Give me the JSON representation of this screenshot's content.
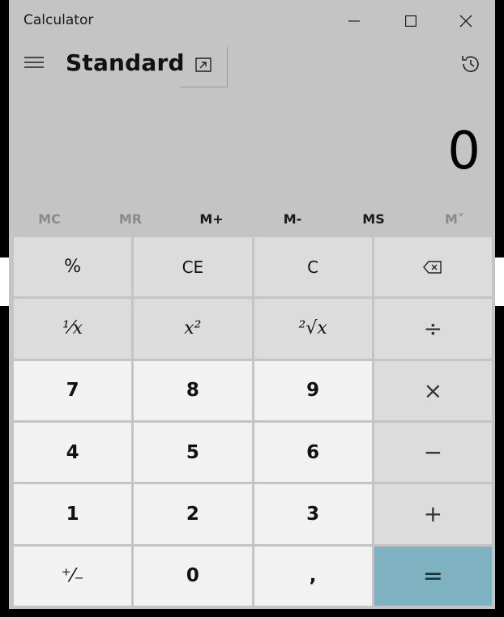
{
  "window": {
    "title": "Calculator"
  },
  "header": {
    "mode": "Standard"
  },
  "display": {
    "value": "0"
  },
  "memory": [
    "MC",
    "MR",
    "M+",
    "M-",
    "MS",
    "M˅"
  ],
  "keys": {
    "percent": "%",
    "clear_entry": "CE",
    "clear": "C",
    "reciprocal": "¹⁄x",
    "square": "x²",
    "sqrt": "²√x",
    "divide": "÷",
    "multiply": "×",
    "minus": "−",
    "plus": "+",
    "equals": "=",
    "negate": "⁺⁄₋",
    "decimal": ",",
    "seven": "7",
    "eight": "8",
    "nine": "9",
    "four": "4",
    "five": "5",
    "six": "6",
    "one": "1",
    "two": "2",
    "three": "3",
    "zero": "0"
  },
  "colors": {
    "equals_bg": "#7fb2c1",
    "window_bg": "#c4c4c4"
  },
  "icons": {
    "menu": "hamburger-icon",
    "keep_on_top": "keep-on-top-icon",
    "history": "history-icon",
    "backspace": "backspace-icon"
  }
}
